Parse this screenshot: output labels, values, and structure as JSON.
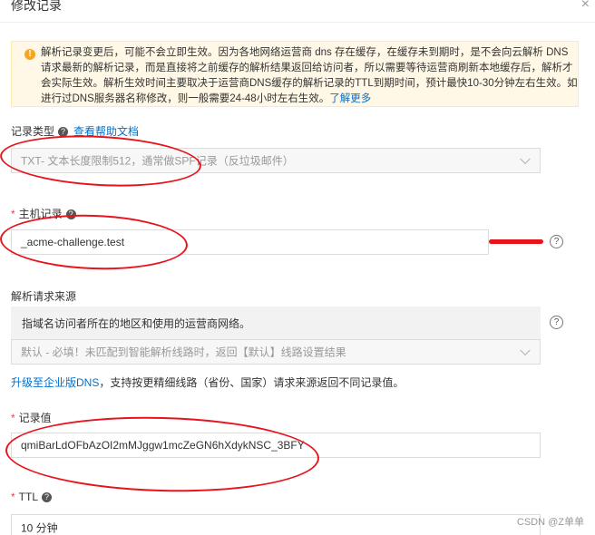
{
  "header": {
    "title": "修改记录",
    "close_symbol": "×"
  },
  "notice": {
    "icon": "!",
    "text": "解析记录变更后，可能不会立即生效。因为各地网络运营商 dns 存在缓存，在缓存未到期时，是不会向云解析 DNS 请求最新的解析记录，而是直接将之前缓存的解析结果返回给访问者，所以需要等待运营商刷新本地缓存后，解析才会实际生效。解析生效时间主要取决于运营商DNS缓存的解析记录的TTL到期时间，预计最快10-30分钟左右生效。如进行过DNS服务器名称修改，则一般需要24-48小时左右生效。",
    "link": "了解更多"
  },
  "record_type": {
    "label": "记录类型",
    "help_link": "查看帮助文档",
    "value": "TXT- 文本长度限制512，通常做SPF记录（反垃圾邮件）"
  },
  "host_record": {
    "label": "主机记录",
    "value": "_acme-challenge.test"
  },
  "resolve_source": {
    "label": "解析请求来源",
    "info": "指域名访问者所在的地区和使用的运营商网络。",
    "select_value": "默认 - 必填！未匹配到智能解析线路时，返回【默认】线路设置结果",
    "upgrade_link": "升级至企业版DNS",
    "upgrade_text": "，支持按更精细线路（省份、国家）请求来源返回不同记录值。"
  },
  "record_value": {
    "label": "记录值",
    "value": "qmiBarLdOFbAzOI2mMJggw1mcZeGN6hXdykNSC_3BFY"
  },
  "ttl": {
    "label": "TTL",
    "value": "10 分钟"
  },
  "watermark": "CSDN @Z单单",
  "colors": {
    "link": "#0070cc",
    "required": "#e64552",
    "notice_bg": "#fff8e6",
    "annotation": "#e8141c"
  },
  "icons": {
    "notice": "warning-circle-icon",
    "help": "question-circle-icon",
    "close": "close-icon",
    "dropdown": "chevron-down-icon"
  }
}
